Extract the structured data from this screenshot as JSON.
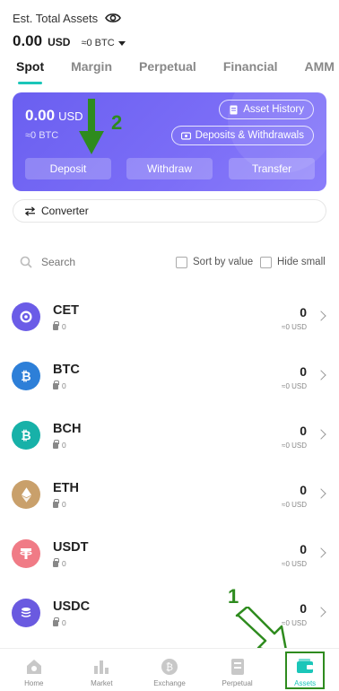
{
  "header": {
    "est_label": "Est. Total Assets",
    "total_value": "0.00",
    "total_currency": "USD",
    "btc_equiv": "≈0 BTC"
  },
  "tabs": [
    {
      "label": "Spot",
      "active": true
    },
    {
      "label": "Margin",
      "active": false
    },
    {
      "label": "Perpetual",
      "active": false
    },
    {
      "label": "Financial",
      "active": false
    },
    {
      "label": "AMM",
      "active": false
    }
  ],
  "card": {
    "balance_value": "0.00",
    "balance_currency": "USD",
    "btc_equiv": "≈0 BTC",
    "asset_history": "Asset History",
    "deposits_withdrawals": "Deposits & Withdrawals",
    "deposit": "Deposit",
    "withdraw": "Withdraw",
    "transfer": "Transfer",
    "gradient_start": "#6a5ff0",
    "gradient_end": "#8a7dfa"
  },
  "converter": {
    "label": "Converter"
  },
  "search": {
    "placeholder": "Search",
    "sort_by_value": "Sort by value",
    "hide_small": "Hide small"
  },
  "coins": [
    {
      "symbol": "CET",
      "locked": "0",
      "amount": "0",
      "usd": "≈0 USD",
      "color": "#6b5ce7"
    },
    {
      "symbol": "BTC",
      "locked": "0",
      "amount": "0",
      "usd": "≈0 USD",
      "color": "#2d7fd8"
    },
    {
      "symbol": "BCH",
      "locked": "0",
      "amount": "0",
      "usd": "≈0 USD",
      "color": "#17b1a8"
    },
    {
      "symbol": "ETH",
      "locked": "0",
      "amount": "0",
      "usd": "≈0 USD",
      "color": "#c9a06b"
    },
    {
      "symbol": "USDT",
      "locked": "0",
      "amount": "0",
      "usd": "≈0 USD",
      "color": "#f07b86"
    },
    {
      "symbol": "USDC",
      "locked": "0",
      "amount": "0",
      "usd": "≈0 USD",
      "color": "#6a5ae0"
    }
  ],
  "nav": [
    {
      "label": "Home",
      "icon": "home-icon"
    },
    {
      "label": "Market",
      "icon": "market-icon"
    },
    {
      "label": "Exchange",
      "icon": "exchange-icon"
    },
    {
      "label": "Perpetual",
      "icon": "perpetual-icon"
    },
    {
      "label": "Assets",
      "icon": "wallet-icon",
      "active": true
    }
  ],
  "annotations": {
    "step1": "1",
    "step2": "2",
    "color": "#2e8b1e"
  },
  "accent": "#1bc6b9"
}
